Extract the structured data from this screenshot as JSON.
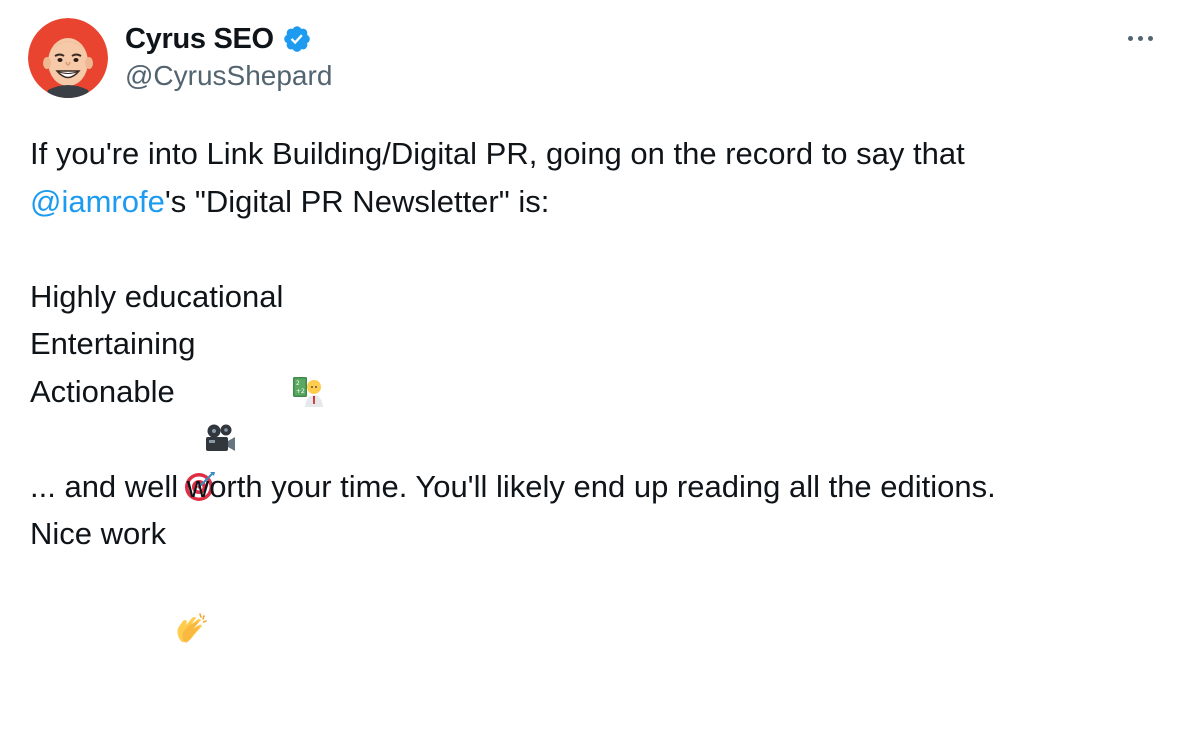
{
  "author": {
    "display_name": "Cyrus SEO",
    "handle": "@CyrusShepard",
    "verified": true
  },
  "icons": {
    "verified": "verified-badge-icon",
    "more": "more-options-icon"
  },
  "colors": {
    "mention": "#1d9bf0",
    "verified": "#1d9bf0",
    "text": "#0f1419",
    "secondary": "#536471"
  },
  "tweet": {
    "line1": "If you're into Link Building/Digital PR, going on the record to say that",
    "mention": "@iamrofe",
    "line2_rest": "'s \"Digital PR Newsletter\" is:",
    "item1": "Highly educational",
    "item1_emoji": "teacher-emoji",
    "item2": "Entertaining",
    "item2_emoji": "movie-camera-emoji",
    "item3": "Actionable",
    "item3_emoji": "direct-hit-emoji",
    "line_closing": "... and well worth your time. You'll likely end up reading all the editions.",
    "line_last": "Nice work",
    "line_last_emoji": "clapping-hands-emoji"
  }
}
